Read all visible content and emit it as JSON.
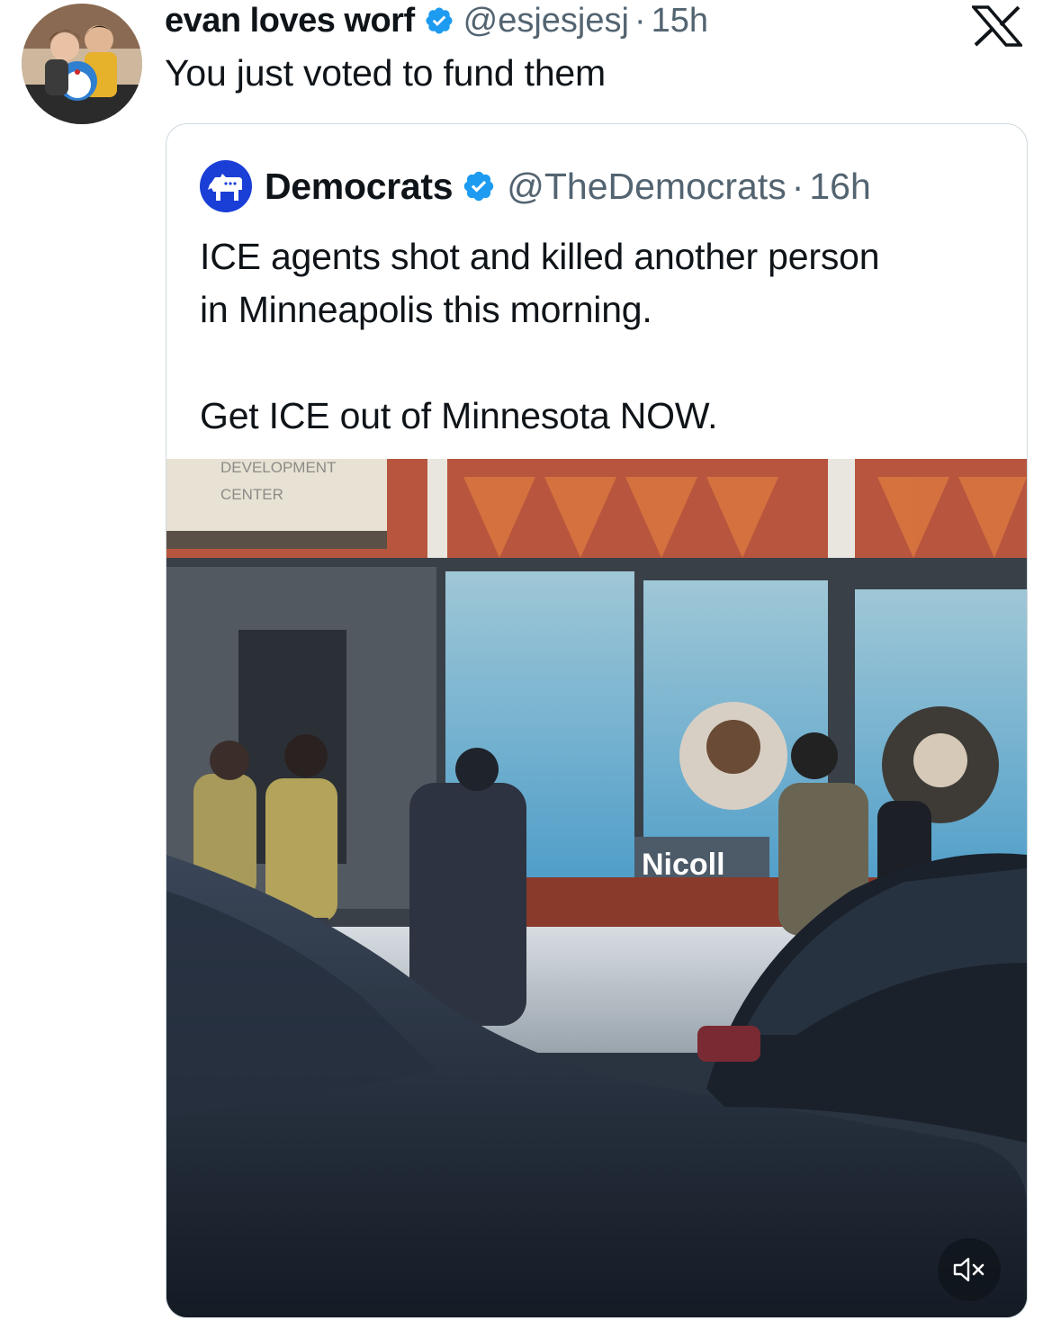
{
  "tweet": {
    "display_name": "evan loves worf",
    "handle": "@esjesjesj",
    "separator": "·",
    "time": "15h",
    "text": "You just voted to fund them",
    "avatar_icon": "profile-photo-avatar",
    "verified_icon": "verified-badge-icon"
  },
  "platform": {
    "logo": "x-logo-icon"
  },
  "quoted_tweet": {
    "display_name": "Democrats",
    "handle": "@TheDemocrats",
    "separator": "·",
    "time": "16h",
    "avatar_icon": "democrats-donkey-logo",
    "text_lines": [
      "ICE agents shot and killed another person",
      "in Minneapolis this morning.",
      "Get ICE out of Minnesota NOW."
    ],
    "media": {
      "type": "video",
      "sign_text": [
        "DEVELOPMENT",
        "CENTER"
      ],
      "storefront_text": "Nicoll",
      "mute_icon": "speaker-muted-icon"
    }
  },
  "colors": {
    "text_primary": "#0f1419",
    "text_secondary": "#536471",
    "verified_blue": "#1d9bf0",
    "border": "#cfd9de",
    "democrats_blue": "#1a3fd6"
  }
}
